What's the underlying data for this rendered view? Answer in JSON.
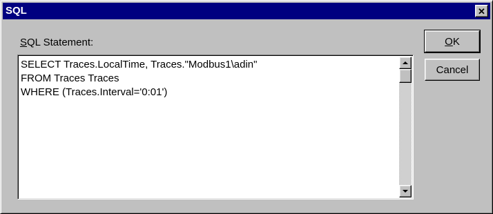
{
  "window": {
    "title": "SQL",
    "close_glyph": "✕"
  },
  "sql": {
    "label_mnemonic": "S",
    "label_rest": "QL Statement:",
    "statement_lines": [
      "SELECT Traces.LocalTime, Traces.\"Modbus1\\adin\"",
      "FROM Traces Traces",
      "WHERE (Traces.Interval='0:01')"
    ]
  },
  "buttons": {
    "ok_mnemonic": "O",
    "ok_rest": "K",
    "cancel": "Cancel"
  },
  "icons": {
    "close": "close-icon",
    "scroll_up": "scroll-up-arrow-icon",
    "scroll_down": "scroll-down-arrow-icon"
  },
  "colors": {
    "titlebar": "#000080",
    "face": "#c0c0c0"
  }
}
